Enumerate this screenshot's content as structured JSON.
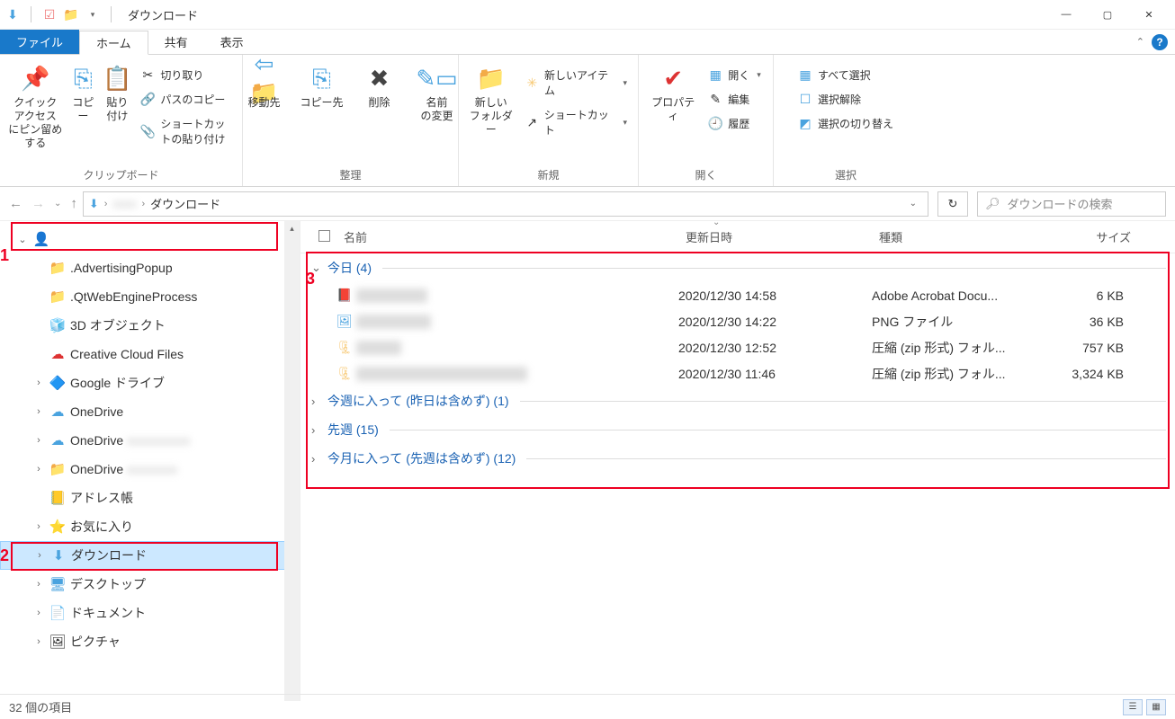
{
  "window": {
    "title": "ダウンロード"
  },
  "tabs": {
    "file": "ファイル",
    "home": "ホーム",
    "share": "共有",
    "view": "表示"
  },
  "ribbon": {
    "clipboard": {
      "pin": "クイック アクセス\nにピン留めする",
      "copy": "コピー",
      "paste": "貼り付け",
      "copy_path": "パスのコピー",
      "paste_shortcut": "ショートカットの貼り付け",
      "cut": "切り取り",
      "label": "クリップボード"
    },
    "organize": {
      "move_to": "移動先",
      "copy_to": "コピー先",
      "delete": "削除",
      "rename": "名前\nの変更",
      "label": "整理"
    },
    "new": {
      "new_folder": "新しい\nフォルダー",
      "new_item": "新しいアイテム",
      "shortcut": "ショートカット",
      "label": "新規"
    },
    "open": {
      "properties": "プロパティ",
      "open": "開く",
      "edit": "編集",
      "history": "履歴",
      "label": "開く"
    },
    "select": {
      "select_all": "すべて選択",
      "select_none": "選択解除",
      "invert": "選択の切り替え",
      "label": "選択"
    }
  },
  "address": {
    "segment": "ダウンロード",
    "search_placeholder": "ダウンロードの検索"
  },
  "sidebar": {
    "user": "  ",
    "items": [
      ".AdvertisingPopup",
      ".QtWebEngineProcess",
      "3D オブジェクト",
      "Creative Cloud Files",
      "Google ドライブ",
      "OneDrive",
      "OneDrive",
      "OneDrive",
      "アドレス帳",
      "お気に入り",
      "ダウンロード",
      "デスクトップ",
      "ドキュメント",
      "ピクチャ"
    ]
  },
  "columns": {
    "name": "名前",
    "date": "更新日時",
    "type": "種類",
    "size": "サイズ"
  },
  "groups": {
    "today": "今日 (4)",
    "this_week": "今週に入って (昨日は含めず) (1)",
    "last_week": "先週 (15)",
    "this_month": "今月に入って (先週は含めず) (12)"
  },
  "files": [
    {
      "name": "xxxxxxxx.pdf",
      "date": "2020/12/30 14:58",
      "type": "Adobe Acrobat Docu...",
      "size": "6 KB"
    },
    {
      "name": "xxxxxxxx.png",
      "date": "2020/12/30 14:22",
      "type": "PNG ファイル",
      "size": "36 KB"
    },
    {
      "name": "xxxx.zip",
      "date": "2020/12/30 12:52",
      "type": "圧縮 (zip 形式) フォル...",
      "size": "757 KB"
    },
    {
      "name": "xxxxxxxxxxxxxxxxxxxxxxxx.zip",
      "date": "2020/12/30 11:46",
      "type": "圧縮 (zip 形式) フォル...",
      "size": "3,324 KB"
    }
  ],
  "status": {
    "count": "32 個の項目"
  },
  "annotations": {
    "a1": "1",
    "a2": "2",
    "a3": "3"
  }
}
